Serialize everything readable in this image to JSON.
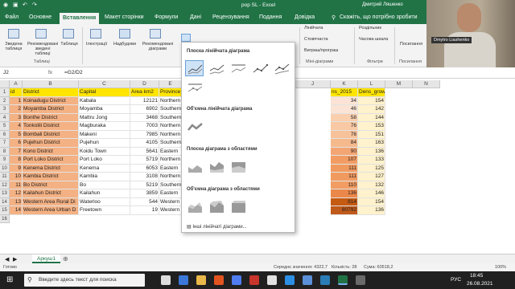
{
  "app": {
    "title": "pop SL - Excel",
    "user": "Дмитрий Ляшенко"
  },
  "tabs": [
    "Файл",
    "Основне",
    "Вставлення",
    "Макет сторінки",
    "Формули",
    "Дані",
    "Рецензування",
    "Подання",
    "Довідка"
  ],
  "active_tab": "Вставлення",
  "tell_me": "Скажіть, що потрібно зробити",
  "ribbon": {
    "btn_pivot": "Зведена таблиця",
    "btn_rec_pivot": "Рекомендовані зведені таблиці",
    "btn_table": "Таблиця",
    "btn_illustrations": "Ілюстрації",
    "btn_addins": "Надбудови",
    "btn_rec_charts": "Рекомендовані діаграми",
    "spark_line": "Лінійчата",
    "spark_column": "Стовпчаста",
    "spark_winloss": "Виграш/програш",
    "filter_slicer": "Роздільник",
    "filter_timeline": "Часова шкала",
    "btn_link": "Посилання",
    "group_tables": "Таблиці",
    "group_spark": "Міні-діаграми",
    "group_filters": "Фільтри",
    "group_links": "Посилання"
  },
  "video_name": "Dmytro Liashenko",
  "formula_bar": {
    "cell": "J2",
    "formula": "=G2/D2"
  },
  "columns": [
    "A",
    "B",
    "C",
    "D",
    "E",
    "F",
    "G",
    "H",
    "I",
    "J",
    "K",
    "L",
    "M",
    "N"
  ],
  "headers": {
    "id": "id",
    "district": "District",
    "capital": "Capital",
    "area": "Area km2",
    "province": "Province",
    "pop2015": "ns_2015",
    "dens_growth": "Dens_growth"
  },
  "rows": [
    {
      "id": "1",
      "district": "Koinadugu District",
      "capital": "Kabala",
      "area": "12121",
      "province": "Northern",
      "k": "34",
      "l": "154"
    },
    {
      "id": "2",
      "district": "Moyamba District",
      "capital": "Moyamba",
      "area": "6902",
      "province": "Southern",
      "k": "46",
      "l": "142"
    },
    {
      "id": "3",
      "district": "Bonthe District",
      "capital": "Mattru Jong",
      "area": "3468",
      "province": "Southern",
      "k": "58",
      "l": "144"
    },
    {
      "id": "4",
      "district": "Tonkolili District",
      "capital": "Magburaka",
      "area": "7003",
      "province": "Northern",
      "k": "76",
      "l": "153"
    },
    {
      "id": "5",
      "district": "Bombali District",
      "capital": "Makeni",
      "area": "7985",
      "province": "Northern",
      "k": "76",
      "l": "151"
    },
    {
      "id": "6",
      "district": "Pujehun District",
      "capital": "Pujehun",
      "area": "4105",
      "province": "Southern",
      "k": "84",
      "l": "163"
    },
    {
      "id": "7",
      "district": "Kono District",
      "capital": "Koidu Town",
      "area": "5641",
      "province": "Eastern",
      "k": "90",
      "l": "136"
    },
    {
      "id": "8",
      "district": "Port Loko District",
      "capital": "Port Loko",
      "area": "5719",
      "province": "Northern",
      "k": "107",
      "l": "133"
    },
    {
      "id": "9",
      "district": "Kenema District",
      "capital": "Kenema",
      "area": "6053",
      "province": "Eastern",
      "k": "111",
      "l": "125"
    },
    {
      "id": "10",
      "district": "Kambia District",
      "capital": "Kambia",
      "area": "3108",
      "province": "Northern",
      "k": "111",
      "l": "127"
    },
    {
      "id": "11",
      "district": "Bo District",
      "capital": "Bo",
      "area": "5219",
      "province": "Southern",
      "k": "110",
      "l": "132"
    },
    {
      "id": "12",
      "district": "Kailahun District",
      "capital": "Kailahun",
      "area": "3859",
      "province": "Eastern",
      "k": "136",
      "l": "146"
    },
    {
      "id": "13",
      "district": "Western Area Rural Di",
      "capital": "Waterloo",
      "area": "544",
      "province": "Western",
      "k": "814",
      "l": "154"
    },
    {
      "id": "14",
      "district": "Western Area Urban D",
      "capital": "Freetown",
      "area": "19",
      "province": "Western",
      "k": "80792",
      "l": "136"
    }
  ],
  "dropdown": {
    "sec_line2d": "Плоска лінійчата діаграма",
    "sec_line3d": "Об'ємна лінійчата діаграма",
    "sec_area2d": "Плоска діаграма з областями",
    "sec_area3d": "Об'ємна діаграма з областями",
    "more": "Інші лінійчаті діаграми..."
  },
  "sheet_tab": "Аркуш1",
  "status": {
    "mode": "Готово",
    "avg": "Середнє значення: 4322,7",
    "count": "Кількість: 28",
    "sum": "Сума: 60518,2",
    "zoom": "100%"
  },
  "taskbar": {
    "search": "Введите здесь текст для поиска",
    "lang": "РУС",
    "time": "18:45",
    "date": "26.08.2021"
  }
}
